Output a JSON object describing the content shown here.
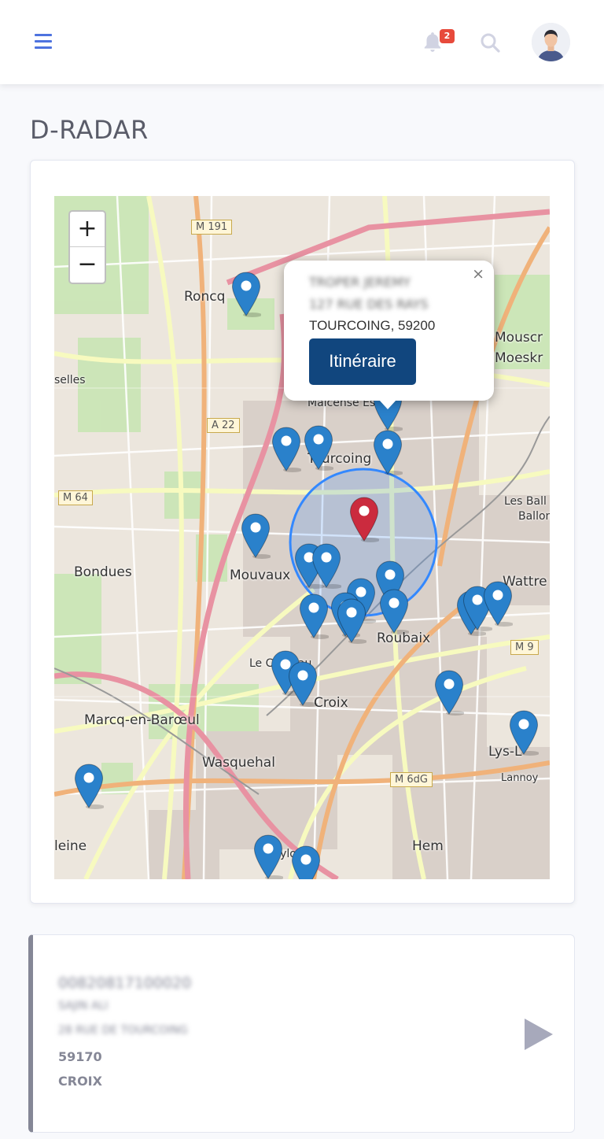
{
  "header": {
    "menu_icon": "bars-icon",
    "notification_icon": "bell-icon",
    "notification_count": "2",
    "search_icon": "search-icon",
    "avatar_icon": "user-avatar-icon"
  },
  "page": {
    "title": "D-RADAR"
  },
  "map": {
    "zoom_in": "+",
    "zoom_out": "−",
    "labels": {
      "roncq": "Roncq",
      "bondues": "Bondues",
      "mouvaux": "Mouvaux",
      "marcq": "Marcq-en-Barœul",
      "wasquehal": "Wasquehal",
      "croix": "Croix",
      "le_capreau": "Le Capreau",
      "roubaix": "Roubaix",
      "wattrelos": "Wattre",
      "les_ballons": "Les Ball",
      "ballons2": "Ballon",
      "mouscron": "Mouscr",
      "moeskroen": "Moeskr",
      "hem": "Hem",
      "babylone": "Babylone",
      "lannoy": "Lannoy",
      "lys": "Lys-L",
      "selles": "selles",
      "leine": "leine",
      "tourcoing": "Tourcoing",
      "maison": "Malcense Est"
    },
    "roads": {
      "m191": "M 191",
      "a22": "A 22",
      "m64": "M 64",
      "m9": "M 9",
      "m6dg": "M 6dG"
    },
    "popup": {
      "name": "TROPER JEREMY",
      "street": "127 RUE DES RAYS",
      "city": "TOURCOING, 59200",
      "button": "Itinéraire",
      "close": "×"
    },
    "colors": {
      "marker": "#2a81cb",
      "selected_marker": "#cb2b3e",
      "radius": "#3388ff",
      "button": "#11467e"
    }
  },
  "detail": {
    "code": "00820817100020",
    "name": "SAJIN ALI",
    "street": "28 RUE DE TOURCOING",
    "postcode": "59170",
    "city": "CROIX",
    "play_icon": "play-icon"
  }
}
